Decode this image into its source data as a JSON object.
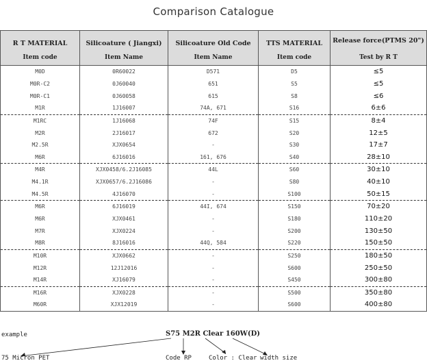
{
  "title": "Comparison Catalogue",
  "headers": [
    {
      "top": "R T MATERIAL",
      "bottom": "Item code"
    },
    {
      "top": "Silicoature ( Jiangxi)",
      "bottom": "Item Name"
    },
    {
      "top": "Silicoature Old Code",
      "bottom": "Item Name"
    },
    {
      "top": "TTS  MATERIAL",
      "bottom": "Item code"
    },
    {
      "top": "Release force(PTMS 20\")",
      "bottom": "Test by R T"
    }
  ],
  "rows": [
    [
      "M0D",
      "0R60022",
      "D571",
      "D5",
      "≤5"
    ],
    [
      "M0R-C2",
      "0J60040",
      "651",
      "S5",
      "≤5"
    ],
    [
      "M0R-C1",
      "0J60058",
      "615",
      "S8",
      "≤6"
    ],
    [
      "M1R",
      "1J16007",
      "74A, 671",
      "S16",
      "6±6"
    ],
    [
      "M1RC",
      "1J16068",
      "74F",
      "S15",
      "8±4"
    ],
    [
      "M2R",
      "2J16017",
      "672",
      "S20",
      "12±5"
    ],
    [
      "M2.5R",
      "XJX0654",
      "-",
      "S30",
      "17±7"
    ],
    [
      "M6R",
      "6J16016",
      "161, 676",
      "S40",
      "28±10"
    ],
    [
      "M4R",
      "XJX0458/6.2J16085",
      "44L",
      "S60",
      "30±10"
    ],
    [
      "M4.1R",
      "XJX0657/6.2J16086",
      "-",
      "S80",
      "40±10"
    ],
    [
      "M4.5R",
      "4J16070",
      "-",
      "S100",
      "50±15"
    ],
    [
      "M6R",
      "6J16019",
      "44I, 674",
      "S150",
      "70±20"
    ],
    [
      "M6R",
      "XJX0461",
      "-",
      "S180",
      "110±20"
    ],
    [
      "M7R",
      "XJX0224",
      "-",
      "S200",
      "130±50"
    ],
    [
      "M8R",
      "8J16016",
      "44Q, 584",
      "S220",
      "150±50"
    ],
    [
      "M10R",
      "XJX0662",
      "-",
      "S250",
      "180±50"
    ],
    [
      "M12R",
      "12J12016",
      "-",
      "S600",
      "250±50"
    ],
    [
      "M14R",
      "XJ16079",
      "-",
      "S450",
      "300±80"
    ],
    [
      "M16R",
      "XJX0228",
      "-",
      "S500",
      "350±80"
    ],
    [
      "M60R",
      "XJX12019",
      "-",
      "S600",
      "400±80"
    ]
  ],
  "example": {
    "label": "example",
    "code": "S75 M2R Clear 160W(D)",
    "parts": [
      "75 Micron PET",
      "Code RP",
      "Color : Clear",
      "width size"
    ]
  }
}
